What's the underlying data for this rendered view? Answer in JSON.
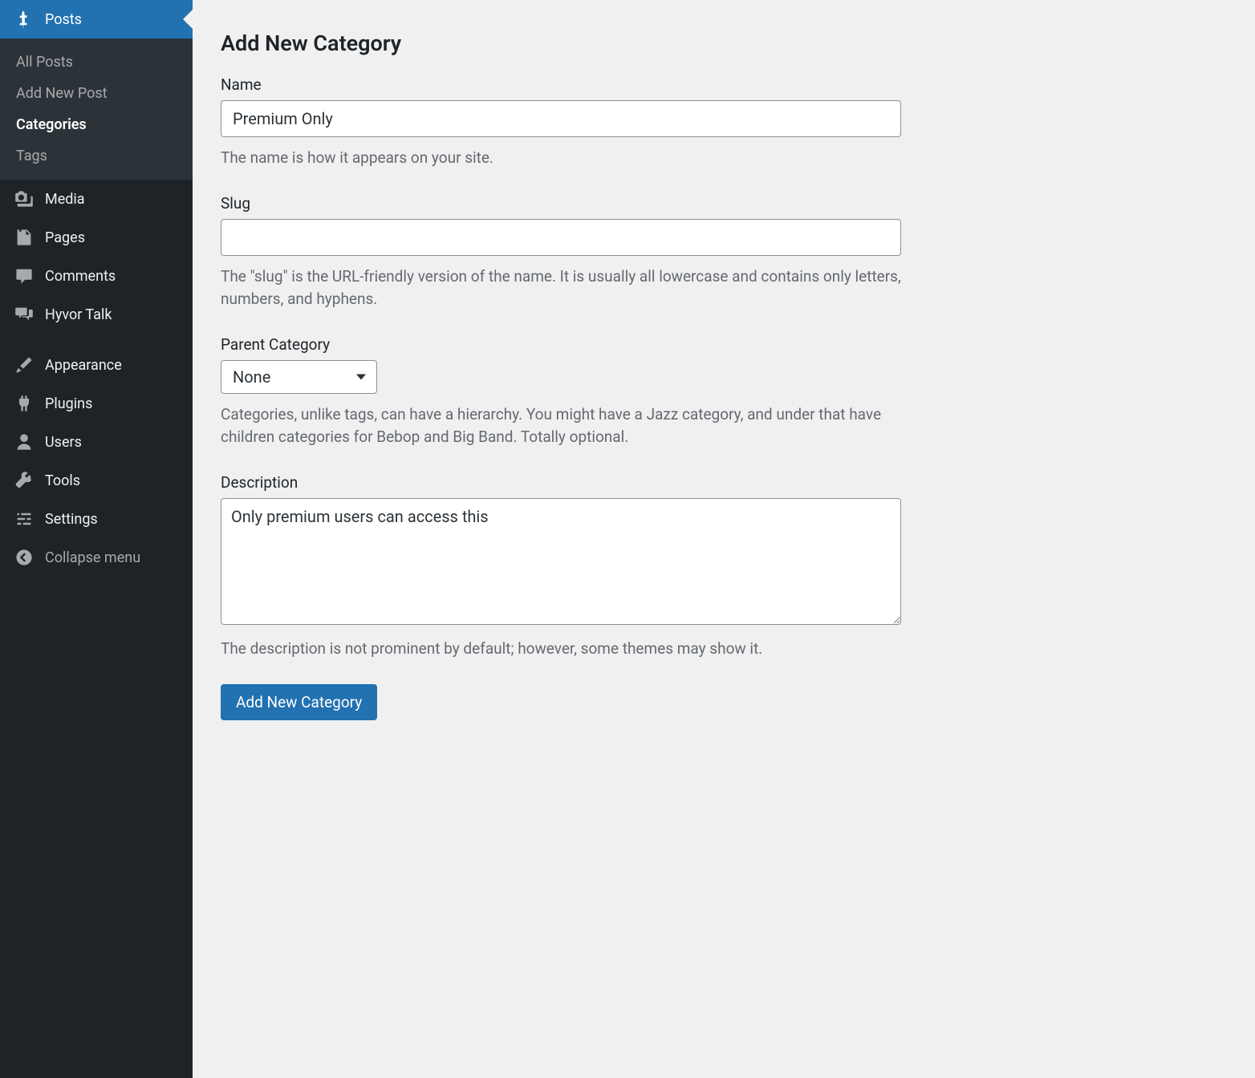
{
  "sidebar": {
    "posts": {
      "label": "Posts",
      "submenu": {
        "all_posts": "All Posts",
        "add_new": "Add New Post",
        "categories": "Categories",
        "tags": "Tags"
      }
    },
    "media": "Media",
    "pages": "Pages",
    "comments": "Comments",
    "hyvor_talk": "Hyvor Talk",
    "appearance": "Appearance",
    "plugins": "Plugins",
    "users": "Users",
    "tools": "Tools",
    "settings": "Settings",
    "collapse": "Collapse menu"
  },
  "main": {
    "title": "Add New Category",
    "name": {
      "label": "Name",
      "value": "Premium Only",
      "help": "The name is how it appears on your site."
    },
    "slug": {
      "label": "Slug",
      "value": "",
      "help": "The \"slug\" is the URL-friendly version of the name. It is usually all lowercase and contains only letters, numbers, and hyphens."
    },
    "parent": {
      "label": "Parent Category",
      "value": "None",
      "help": "Categories, unlike tags, can have a hierarchy. You might have a Jazz category, and under that have children categories for Bebop and Big Band. Totally optional."
    },
    "description": {
      "label": "Description",
      "value": "Only premium users can access this",
      "help": "The description is not prominent by default; however, some themes may show it."
    },
    "submit": "Add New Category"
  }
}
